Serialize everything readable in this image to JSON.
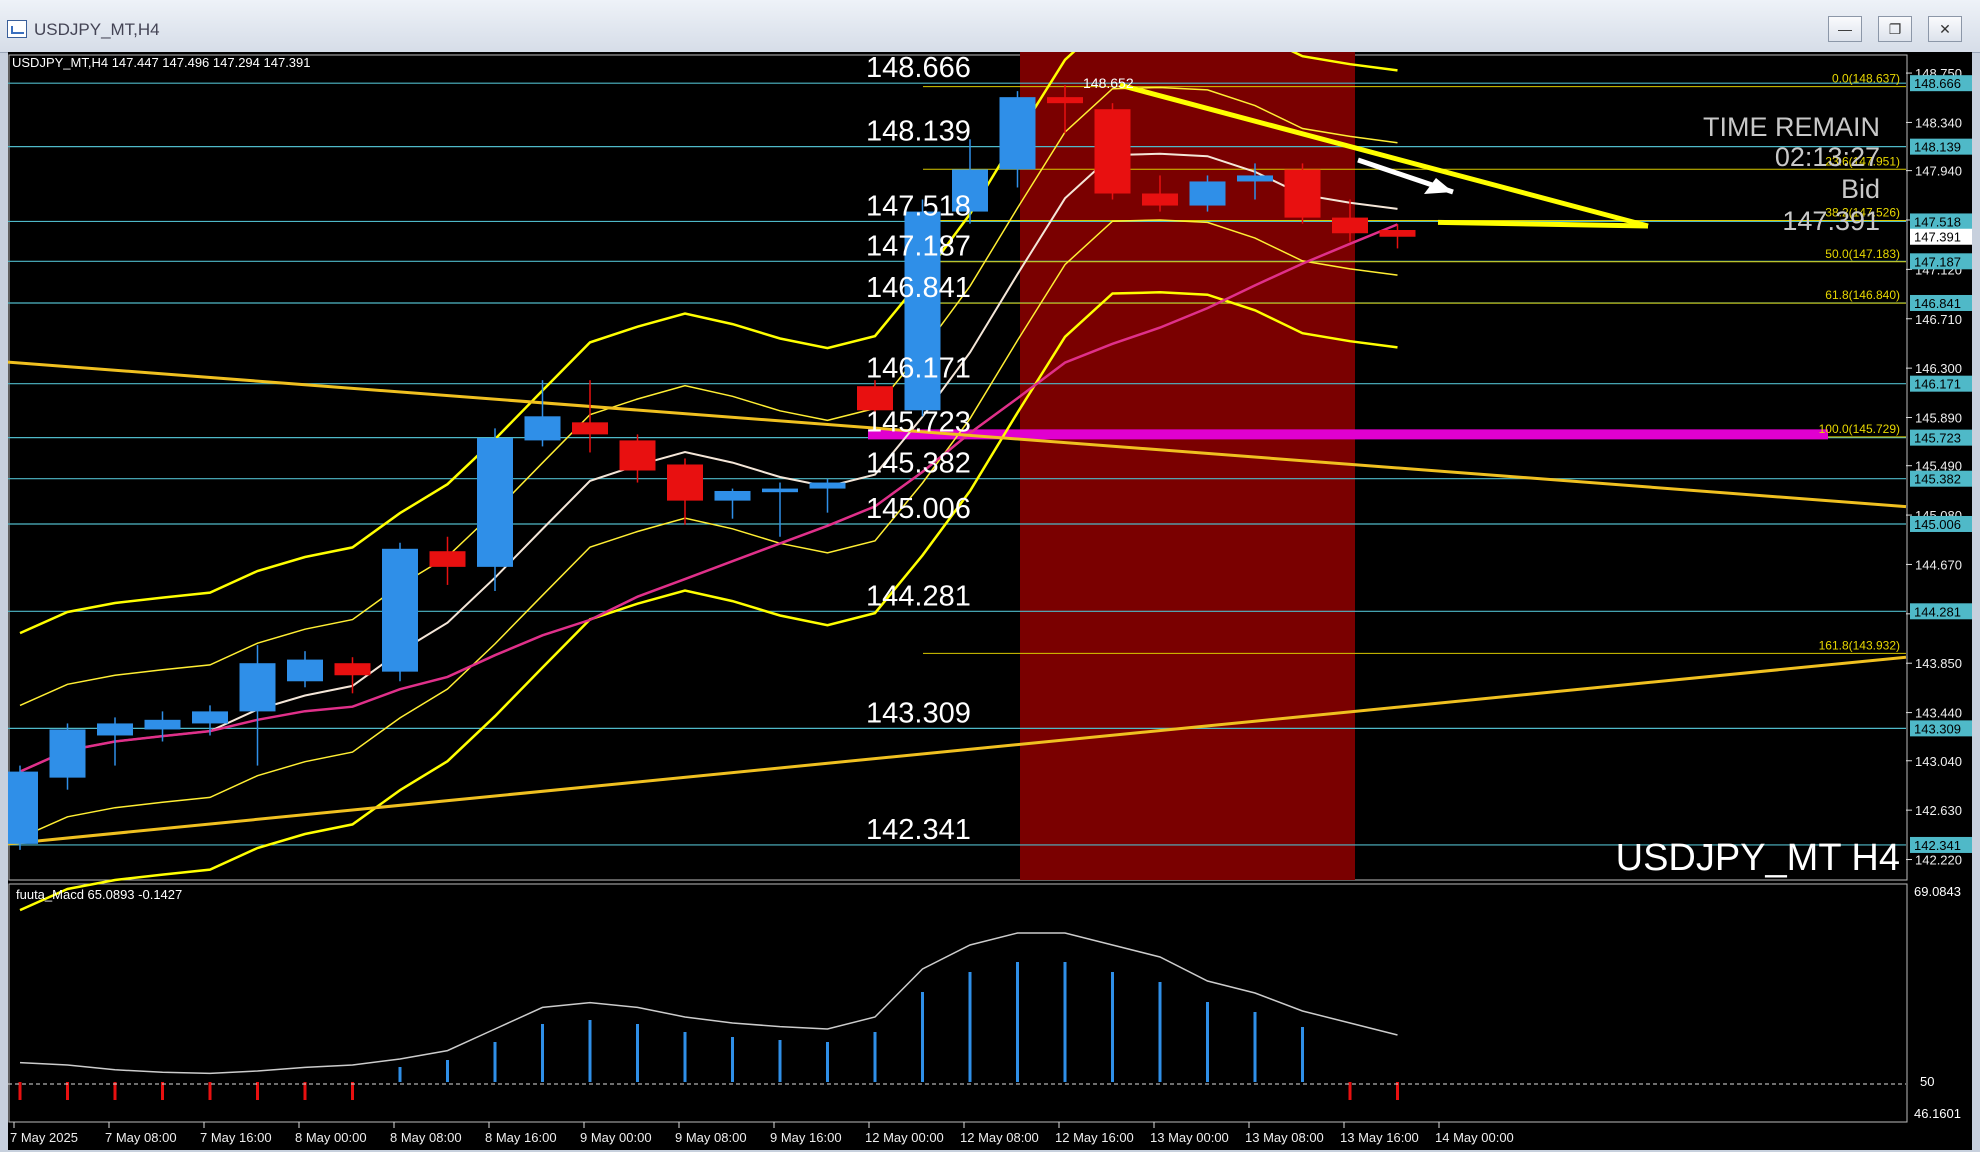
{
  "window": {
    "title": "USDJPY_MT,H4",
    "buttons": [
      "minimize",
      "restore",
      "close"
    ]
  },
  "chart_header": "USDJPY_MT,H4  147.447 147.496 147.294 147.391",
  "watermark": "USDJPY_MT H4",
  "time_remain": {
    "label": "TIME REMAIN",
    "value": "02:13:27",
    "bid_label": "Bid",
    "bid_value": "147.391"
  },
  "high_marker": "148.652",
  "level_labels": [
    {
      "text": "148.666",
      "price": 148.666
    },
    {
      "text": "148.139",
      "price": 148.139
    },
    {
      "text": "147.518",
      "price": 147.518
    },
    {
      "text": "147.187",
      "price": 147.187
    },
    {
      "text": "146.841",
      "price": 146.841
    },
    {
      "text": "146.171",
      "price": 146.171
    },
    {
      "text": "145.723",
      "price": 145.723
    },
    {
      "text": "145.382",
      "price": 145.382
    },
    {
      "text": "145.006",
      "price": 145.006
    },
    {
      "text": "144.281",
      "price": 144.281
    },
    {
      "text": "143.309",
      "price": 143.309
    },
    {
      "text": "142.341",
      "price": 142.341
    }
  ],
  "fib_labels": [
    {
      "text": "0.0(148.637)",
      "price": 148.637
    },
    {
      "text": "23.6(147.951)",
      "price": 147.951
    },
    {
      "text": "38.2(147.526)",
      "price": 147.526
    },
    {
      "text": "50.0(147.183)",
      "price": 147.183
    },
    {
      "text": "61.8(146.840)",
      "price": 146.84
    },
    {
      "text": "100.0(145.729)",
      "price": 145.729
    },
    {
      "text": "161.8(143.932)",
      "price": 143.932
    }
  ],
  "price_axis": {
    "ticks": [
      "148.750",
      "148.340",
      "147.940",
      "147.530",
      "147.120",
      "146.710",
      "146.300",
      "145.890",
      "145.490",
      "145.080",
      "144.670",
      "144.260",
      "143.850",
      "143.440",
      "143.040",
      "142.630",
      "142.220"
    ],
    "tags": [
      "148.666",
      "148.139",
      "147.518",
      "147.391",
      "147.187",
      "146.841",
      "146.171",
      "145.723",
      "145.382",
      "145.006",
      "144.281",
      "143.309",
      "142.341"
    ],
    "current": "147.391"
  },
  "macd": {
    "label": "fuuta_Macd 65.0893  -0.1427",
    "axis": [
      "69.0843",
      "50",
      "46.1601"
    ]
  },
  "time_axis": [
    "7 May 2025",
    "7 May 08:00",
    "7 May 16:00",
    "8 May 00:00",
    "8 May 08:00",
    "8 May 16:00",
    "9 May 00:00",
    "9 May 08:00",
    "9 May 16:00",
    "12 May 00:00",
    "12 May 08:00",
    "12 May 16:00",
    "13 May 00:00",
    "13 May 08:00",
    "13 May 16:00",
    "14 May 00:00"
  ],
  "chart_data": {
    "type": "candlestick",
    "symbol": "USDJPY_MT",
    "timeframe": "H4",
    "ylim": [
      142.05,
      148.9
    ],
    "candles": [
      {
        "o": 142.35,
        "h": 143.0,
        "l": 142.3,
        "c": 142.95
      },
      {
        "o": 142.9,
        "h": 143.35,
        "l": 142.8,
        "c": 143.3
      },
      {
        "o": 143.25,
        "h": 143.4,
        "l": 143.0,
        "c": 143.35
      },
      {
        "o": 143.3,
        "h": 143.45,
        "l": 143.2,
        "c": 143.38
      },
      {
        "o": 143.35,
        "h": 143.5,
        "l": 143.25,
        "c": 143.45
      },
      {
        "o": 143.45,
        "h": 144.0,
        "l": 143.0,
        "c": 143.85
      },
      {
        "o": 143.7,
        "h": 143.95,
        "l": 143.65,
        "c": 143.88
      },
      {
        "o": 143.85,
        "h": 143.9,
        "l": 143.6,
        "c": 143.75
      },
      {
        "o": 143.78,
        "h": 144.85,
        "l": 143.7,
        "c": 144.8
      },
      {
        "o": 144.78,
        "h": 144.9,
        "l": 144.5,
        "c": 144.65
      },
      {
        "o": 144.65,
        "h": 145.8,
        "l": 144.45,
        "c": 145.72
      },
      {
        "o": 145.7,
        "h": 146.2,
        "l": 145.65,
        "c": 145.9
      },
      {
        "o": 145.85,
        "h": 146.2,
        "l": 145.6,
        "c": 145.75
      },
      {
        "o": 145.7,
        "h": 145.75,
        "l": 145.35,
        "c": 145.45
      },
      {
        "o": 145.5,
        "h": 145.55,
        "l": 145.0,
        "c": 145.2
      },
      {
        "o": 145.2,
        "h": 145.3,
        "l": 145.05,
        "c": 145.28
      },
      {
        "o": 145.27,
        "h": 145.35,
        "l": 144.9,
        "c": 145.3
      },
      {
        "o": 145.3,
        "h": 145.38,
        "l": 145.1,
        "c": 145.35
      },
      {
        "o": 146.15,
        "h": 146.2,
        "l": 145.85,
        "c": 145.95
      },
      {
        "o": 145.95,
        "h": 147.7,
        "l": 145.9,
        "c": 147.6
      },
      {
        "o": 147.6,
        "h": 148.2,
        "l": 147.5,
        "c": 147.95
      },
      {
        "o": 147.95,
        "h": 148.6,
        "l": 147.8,
        "c": 148.55
      },
      {
        "o": 148.55,
        "h": 148.65,
        "l": 148.25,
        "c": 148.5
      },
      {
        "o": 148.45,
        "h": 148.5,
        "l": 147.7,
        "c": 147.75
      },
      {
        "o": 147.75,
        "h": 147.9,
        "l": 147.6,
        "c": 147.65
      },
      {
        "o": 147.65,
        "h": 147.9,
        "l": 147.6,
        "c": 147.85
      },
      {
        "o": 147.85,
        "h": 148.0,
        "l": 147.7,
        "c": 147.9
      },
      {
        "o": 147.95,
        "h": 148.0,
        "l": 147.5,
        "c": 147.55
      },
      {
        "o": 147.55,
        "h": 147.7,
        "l": 147.35,
        "c": 147.42
      },
      {
        "o": 147.447,
        "h": 147.496,
        "l": 147.294,
        "c": 147.391
      }
    ]
  }
}
